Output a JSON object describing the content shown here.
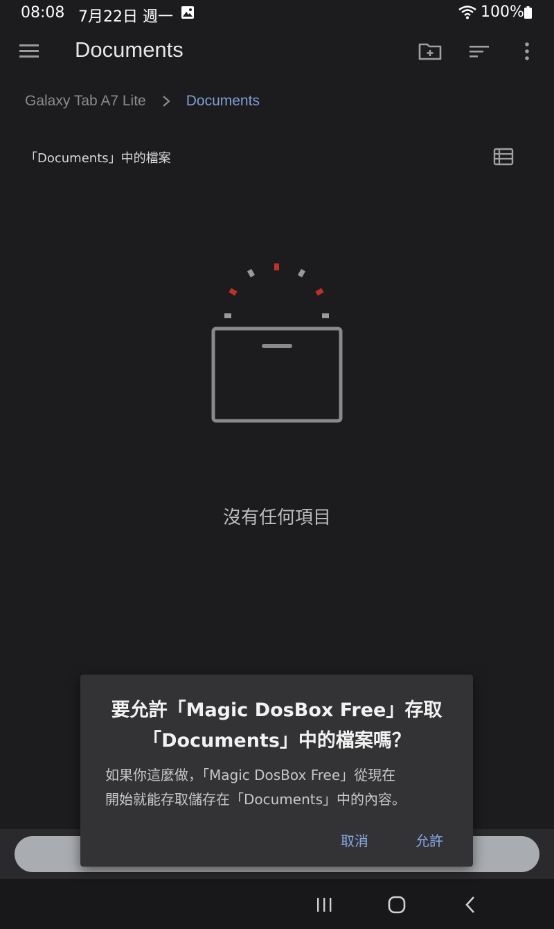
{
  "status_bar": {
    "time": "08:08",
    "date": "7月22日 週一",
    "battery": "100%",
    "icons": [
      "gallery-icon",
      "wifi-icon",
      "battery-icon"
    ]
  },
  "top_bar": {
    "title": "Documents",
    "icons": [
      "hamburger-menu-icon",
      "new-folder-icon",
      "sort-icon",
      "more-options-icon"
    ]
  },
  "breadcrumb": {
    "root": "Galaxy Tab A7 Lite",
    "current": "Documents"
  },
  "section": {
    "label": "「Documents」中的檔案"
  },
  "empty_state": {
    "message": "沒有任何項目"
  },
  "dialog": {
    "title_line1": "要允許「Magic DosBox Free」存取",
    "title_line2": "「Documents」中的檔案嗎？",
    "body_line1": "如果你這麼做，「Magic DosBox Free」從現在",
    "body_line2": "開始就能存取儲存在「Documents」中的內容。",
    "cancel_label": "取消",
    "allow_label": "允許"
  },
  "nav_bar": {
    "icons": [
      "recent-apps-icon",
      "home-icon",
      "back-icon"
    ]
  },
  "colors": {
    "background": "#1c1c1e",
    "dialog": "#333335",
    "accent": "#88a8e6",
    "breadcrumb_current": "#7f9fd6",
    "illustration_red": "#c0302b"
  }
}
